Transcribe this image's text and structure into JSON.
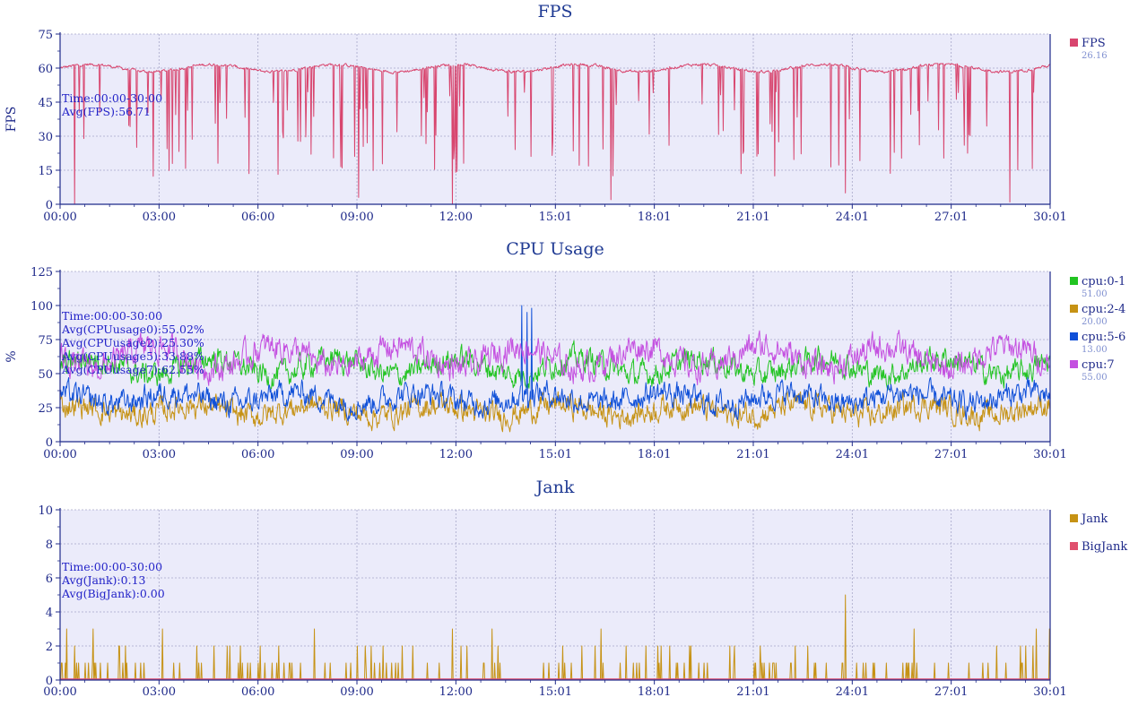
{
  "x_ticks": [
    "00:00",
    "03:00",
    "06:00",
    "09:00",
    "12:00",
    "15:01",
    "18:01",
    "21:01",
    "24:01",
    "27:01",
    "30:01"
  ],
  "colors": {
    "title": "#1f3a93",
    "axis": "#1f2a8a",
    "plot_bg": "#ebebfa",
    "grid": "#a7a7c9",
    "annotation": "#2323c8",
    "fps": "#d8456e",
    "cpu0": "#22c422",
    "cpu2": "#c69214",
    "cpu5": "#1050d8",
    "cpu7": "#c450e0",
    "jank": "#c69214",
    "bigjank": "#e0506e"
  },
  "chart_data": [
    {
      "type": "line",
      "title": "FPS",
      "ylabel": "FPS",
      "xlabel": "",
      "ylim": [
        0,
        75
      ],
      "y_ticks": [
        0,
        15,
        30,
        45,
        60,
        75
      ],
      "x_range": [
        "00:00",
        "30:01"
      ],
      "grid": true,
      "annotations": [
        "Time:00:00-30:00",
        "Avg(FPS):56.71"
      ],
      "legend_position": "right",
      "series": [
        {
          "name": "FPS",
          "legend_value": "26.16",
          "color_key": "fps",
          "baseline": 60,
          "ripple": 1.6,
          "noise": 1.0,
          "dips_per_min": 8,
          "dip_min": 0,
          "min": 0,
          "max": 62,
          "spikes": [
            [
              0.45,
              0
            ],
            [
              16.7,
              2
            ],
            [
              11.9,
              0
            ],
            [
              9.05,
              3
            ],
            [
              23.8,
              5
            ],
            [
              28.8,
              1
            ]
          ]
        }
      ]
    },
    {
      "type": "line",
      "title": "CPU Usage",
      "ylabel": "%",
      "xlabel": "",
      "ylim": [
        0,
        125
      ],
      "y_ticks": [
        0,
        25,
        50,
        75,
        100,
        125
      ],
      "x_range": [
        "00:00",
        "30:01"
      ],
      "grid": true,
      "annotations": [
        "Time:00:00-30:00",
        "Avg(CPUusage0):55.02%",
        "Avg(CPUusage2):25.30%",
        "Avg(CPUusage5):33.88%",
        "Avg(CPUusage7):62.55%"
      ],
      "legend_position": "right",
      "series": [
        {
          "name": "cpu:0-1",
          "legend_value": "51.00",
          "color_key": "cpu0",
          "baseline": 55,
          "ripple": 6,
          "noise": 14,
          "min": 30,
          "max": 82,
          "spikes": []
        },
        {
          "name": "cpu:2-4",
          "legend_value": "20.00",
          "color_key": "cpu2",
          "baseline": 23,
          "ripple": 4,
          "noise": 14,
          "min": 3,
          "max": 50,
          "spikes": []
        },
        {
          "name": "cpu:5-6",
          "legend_value": "13.00",
          "color_key": "cpu5",
          "baseline": 32,
          "ripple": 4,
          "noise": 14,
          "min": 5,
          "max": 100,
          "spikes": [
            [
              14.0,
              100
            ],
            [
              14.15,
              95
            ],
            [
              14.3,
              98
            ]
          ]
        },
        {
          "name": "cpu:7",
          "legend_value": "55.00",
          "color_key": "cpu7",
          "baseline": 62,
          "ripple": 8,
          "noise": 16,
          "min": 33,
          "max": 88,
          "spikes": []
        }
      ]
    },
    {
      "type": "line",
      "title": "Jank",
      "ylabel": "",
      "xlabel": "",
      "ylim": [
        0,
        10
      ],
      "y_ticks": [
        0,
        2,
        4,
        6,
        8,
        10
      ],
      "x_range": [
        "00:00",
        "30:01"
      ],
      "grid": true,
      "annotations": [
        "Time:00:00-30:00",
        "Avg(Jank):0.13",
        "Avg(BigJank):0.00"
      ],
      "legend_position": "right",
      "series": [
        {
          "name": "Jank",
          "legend_value": "",
          "color_key": "jank",
          "type": "spikes",
          "avg": 0.13,
          "spikes": [
            [
              0.2,
              3
            ],
            [
              1.0,
              3
            ],
            [
              3.1,
              3
            ],
            [
              7.7,
              3
            ],
            [
              11.9,
              3
            ],
            [
              13.1,
              3
            ],
            [
              16.4,
              3
            ],
            [
              23.8,
              5
            ],
            [
              25.9,
              3
            ],
            [
              29.6,
              3
            ],
            [
              30.0,
              3
            ]
          ]
        },
        {
          "name": "BigJank",
          "legend_value": "",
          "color_key": "bigjank",
          "type": "flat",
          "value": 0
        }
      ]
    }
  ]
}
